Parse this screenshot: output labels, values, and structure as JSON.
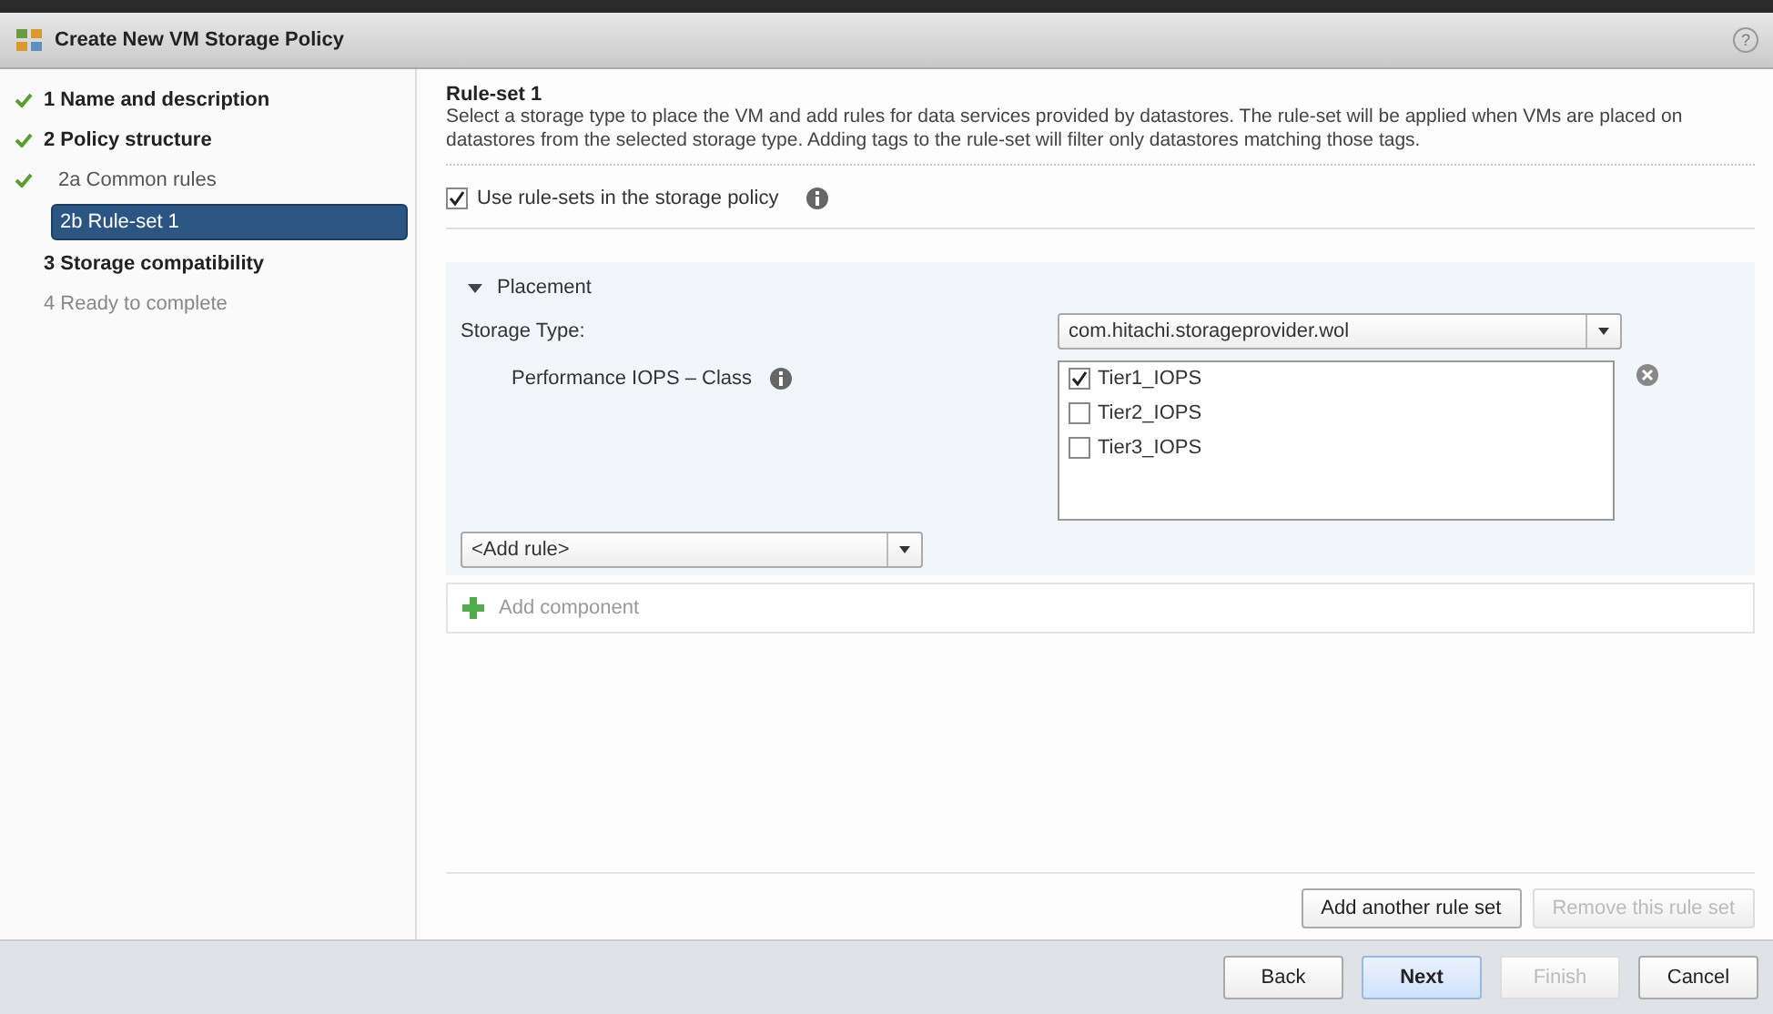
{
  "window": {
    "title": "Create New VM Storage Policy",
    "help": "?"
  },
  "steps": [
    {
      "label": "1 Name and description",
      "completed": true,
      "selected": false,
      "disabled": false
    },
    {
      "label": "2 Policy structure",
      "completed": true,
      "selected": false,
      "disabled": false,
      "children": [
        {
          "label": "2a Common rules",
          "completed": true,
          "selected": false,
          "disabled": false
        },
        {
          "label": "2b Rule-set 1",
          "completed": false,
          "selected": true,
          "disabled": false
        }
      ]
    },
    {
      "label": "3 Storage compatibility",
      "completed": false,
      "selected": false,
      "disabled": false
    },
    {
      "label": "4 Ready to complete",
      "completed": false,
      "selected": false,
      "disabled": true
    }
  ],
  "content": {
    "title": "Rule-set 1",
    "description": "Select a storage type to place the VM and add rules for data services provided by datastores. The rule-set will be applied when VMs are placed on datastores from the selected storage type. Adding tags to the rule-set will filter only datastores matching those tags.",
    "use_rule_sets": {
      "label": "Use rule-sets in the storage policy",
      "checked": true
    },
    "placement": {
      "title": "Placement",
      "expanded": true,
      "storage_type_label": "Storage Type:",
      "storage_type": "com.hitachi.storageprovider.wol",
      "rule": {
        "label": "Performance IOPS – Class",
        "options": [
          {
            "label": "Tier1_IOPS",
            "checked": true
          },
          {
            "label": "Tier2_IOPS",
            "checked": false
          },
          {
            "label": "Tier3_IOPS",
            "checked": false
          }
        ]
      },
      "add_rule": "<Add rule>"
    },
    "add_component": "Add component",
    "rule_set_buttons": [
      {
        "label": "Add another rule set",
        "disabled": false
      },
      {
        "label": "Remove this rule set",
        "disabled": true
      }
    ]
  },
  "footer_buttons": [
    {
      "label": "Back",
      "primary": false,
      "disabled": false
    },
    {
      "label": "Next",
      "primary": true,
      "disabled": false
    },
    {
      "label": "Finish",
      "primary": false,
      "disabled": true
    },
    {
      "label": "Cancel",
      "primary": false,
      "disabled": false
    }
  ]
}
